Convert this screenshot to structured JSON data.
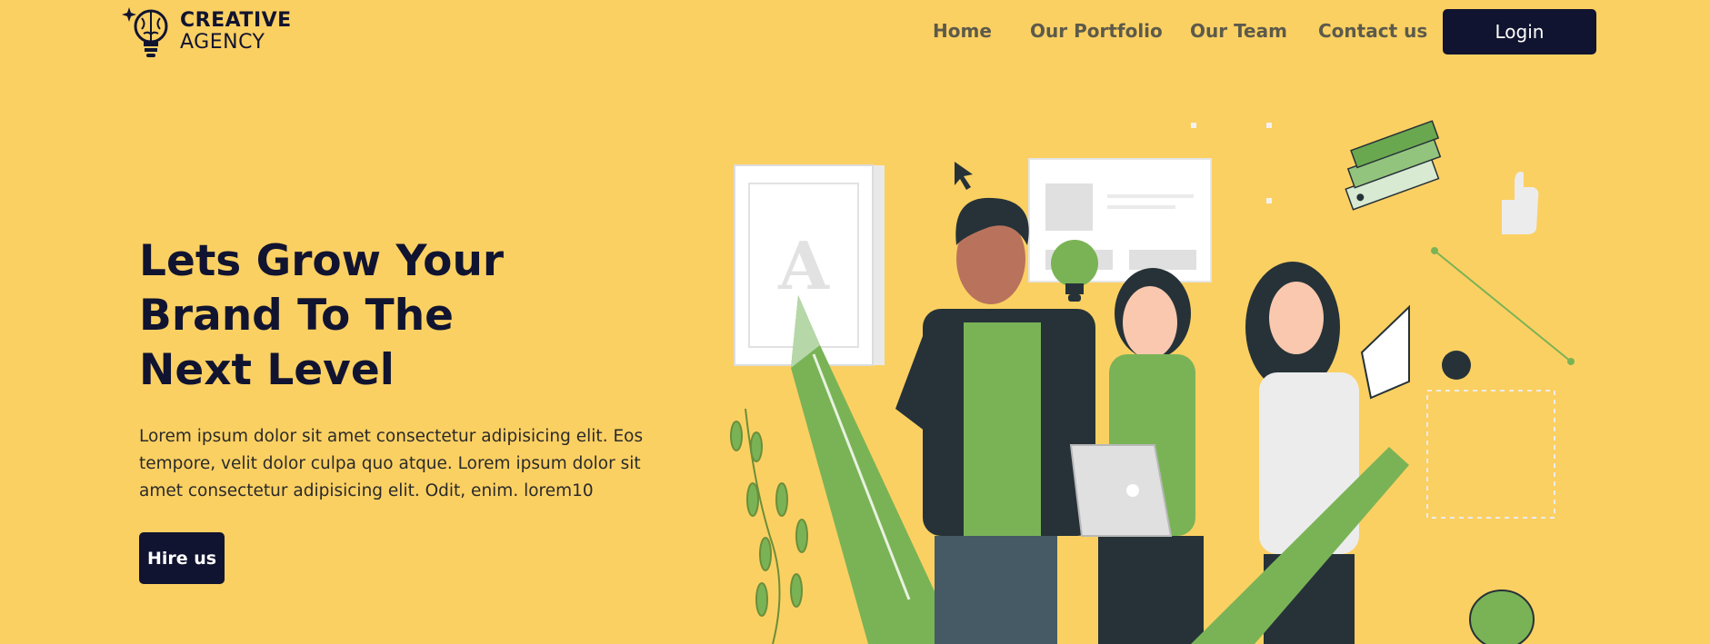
{
  "brand": {
    "line1": "CREATIVE",
    "line2": "AGENCY"
  },
  "nav": {
    "links": [
      {
        "label": "Home"
      },
      {
        "label": "Our Portfolio"
      },
      {
        "label": "Our Team"
      },
      {
        "label": "Contact us"
      }
    ],
    "login_label": "Login"
  },
  "hero": {
    "title_lines": [
      "Lets Grow Your",
      "Brand To The",
      "Next Level"
    ],
    "description": "Lorem ipsum dolor sit amet consectetur adipisicing elit. Eos tempore, velit dolor culpa quo atque. Lorem ipsum dolor sit amet consectetur adipisicing elit. Odit, enim. lorem10",
    "cta_label": "Hire us",
    "illustration": {
      "poster_letter": "A"
    }
  },
  "colors": {
    "background": "#FBD062",
    "primary_dark": "#111430",
    "green": "#7AB356",
    "dark_gray": "#263238"
  },
  "icons": [
    "brain-lightbulb-icon",
    "cursor-icon",
    "lightbulb-icon",
    "thumbs-up-icon"
  ]
}
